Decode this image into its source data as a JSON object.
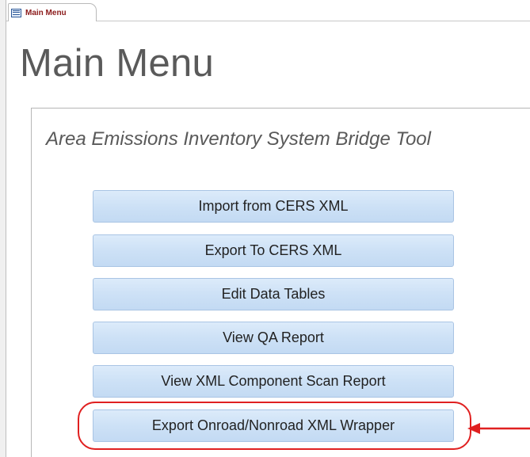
{
  "tab": {
    "label": "Main Menu",
    "icon": "form-icon"
  },
  "page": {
    "title": "Main Menu",
    "subtitle": "Area Emissions Inventory System Bridge Tool"
  },
  "buttons": [
    {
      "label": "Import from CERS XML"
    },
    {
      "label": "Export To CERS XML"
    },
    {
      "label": "Edit Data Tables"
    },
    {
      "label": "View QA Report"
    },
    {
      "label": "View XML Component Scan Report"
    },
    {
      "label": "Export Onroad/Nonroad XML Wrapper"
    }
  ],
  "annotation": {
    "highlight_color": "#e02020",
    "target": "Export Onroad/Nonroad XML Wrapper"
  },
  "colors": {
    "button_fill": "#cde1f6",
    "button_border": "#a9c4e4",
    "tab_label": "#8b1a1a",
    "title_text": "#5a5a5a"
  }
}
